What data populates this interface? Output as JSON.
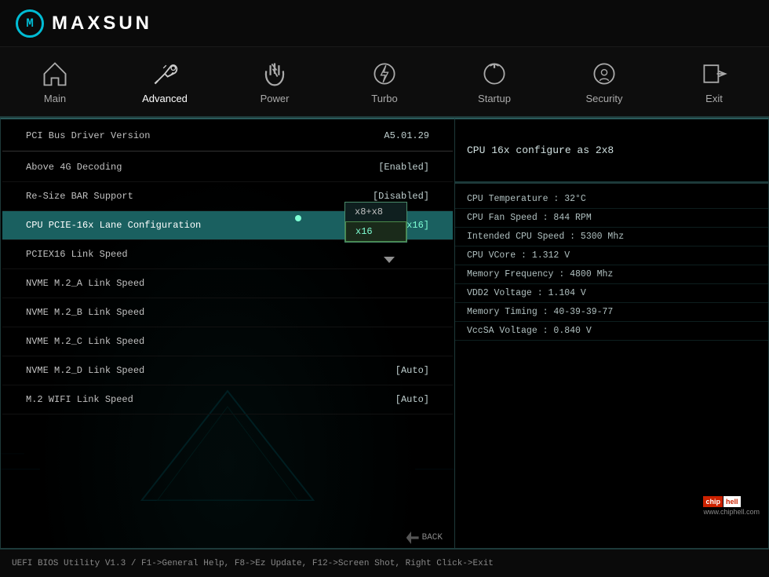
{
  "brand": {
    "name": "MAXSUN"
  },
  "nav": {
    "items": [
      {
        "id": "main",
        "label": "Main",
        "icon": "home"
      },
      {
        "id": "advanced",
        "label": "Advanced",
        "icon": "tools",
        "active": true
      },
      {
        "id": "power",
        "label": "Power",
        "icon": "power"
      },
      {
        "id": "turbo",
        "label": "Turbo",
        "icon": "bolt"
      },
      {
        "id": "startup",
        "label": "Startup",
        "icon": "startup"
      },
      {
        "id": "security",
        "label": "Security",
        "icon": "security"
      },
      {
        "id": "exit",
        "label": "Exit",
        "icon": "exit"
      }
    ]
  },
  "left_panel": {
    "rows": [
      {
        "id": "pci-bus-version",
        "label": "PCI Bus Driver Version",
        "value": "A5.01.29",
        "type": "info"
      },
      {
        "id": "above-4g",
        "label": "Above 4G Decoding",
        "value": "[Enabled]"
      },
      {
        "id": "resize-bar",
        "label": "Re-Size BAR Support",
        "value": "[Disabled]"
      },
      {
        "id": "cpu-pcie-lane",
        "label": "CPU PCIE-16x Lane Configuration",
        "value": "[x16]",
        "highlighted": true
      },
      {
        "id": "pciex16-link",
        "label": "PCIEX16 Link Speed",
        "value": ""
      },
      {
        "id": "nvme-m2a",
        "label": "NVME M.2_A Link Speed",
        "value": ""
      },
      {
        "id": "nvme-m2b",
        "label": "NVME M.2_B Link Speed",
        "value": ""
      },
      {
        "id": "nvme-m2c",
        "label": "NVME M.2_C Link Speed",
        "value": ""
      },
      {
        "id": "nvme-m2d",
        "label": "NVME M.2_D Link Speed",
        "value": "[Auto]"
      },
      {
        "id": "m2-wifi",
        "label": "M.2 WIFI Link Speed",
        "value": "[Auto]"
      }
    ],
    "dropdown": {
      "options": [
        {
          "label": "x8+x8",
          "selected": false
        },
        {
          "label": "x16",
          "selected": true
        }
      ]
    }
  },
  "right_panel": {
    "info_text": "CPU 16x configure as 2x8",
    "stats": [
      {
        "label": "CPU Temperature : 32°C"
      },
      {
        "label": "CPU Fan Speed : 844 RPM"
      },
      {
        "label": "Intended CPU Speed : 5300 Mhz"
      },
      {
        "label": "CPU VCore : 1.312 V"
      },
      {
        "label": "Memory Frequency : 4800 Mhz"
      },
      {
        "label": "VDD2 Voltage : 1.104 V"
      },
      {
        "label": "Memory Timing : 40-39-39-77"
      },
      {
        "label": "VccSA Voltage : 0.840 V"
      }
    ]
  },
  "footer": {
    "text": "UEFI BIOS Utility V1.3 / F1->General Help, F8->Ez Update, F12->Screen Shot, Right Click->Exit"
  },
  "watermark": "www.chiphell.com",
  "back_label": "BACK"
}
